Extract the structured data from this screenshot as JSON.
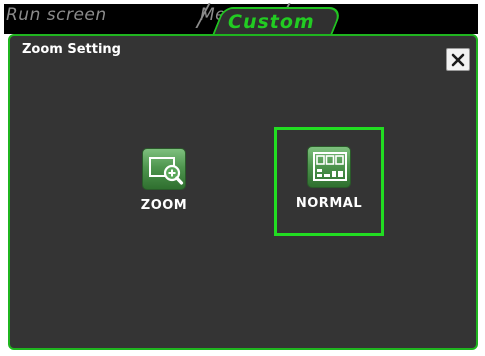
{
  "tabs": [
    {
      "label": "Run screen",
      "active": false
    },
    {
      "label": "Menu",
      "active": false
    },
    {
      "label": "Custom",
      "active": true
    }
  ],
  "dialog": {
    "title": "Zoom Setting",
    "close_label": "×"
  },
  "options": [
    {
      "label": "ZOOM",
      "icon": "zoom-in-icon",
      "selected": false
    },
    {
      "label": "NORMAL",
      "icon": "normal-layout-icon",
      "selected": true
    }
  ],
  "colors": {
    "accent": "#22cc22",
    "panel_bg": "#343434",
    "tab_inactive": "#8c8c8c"
  }
}
